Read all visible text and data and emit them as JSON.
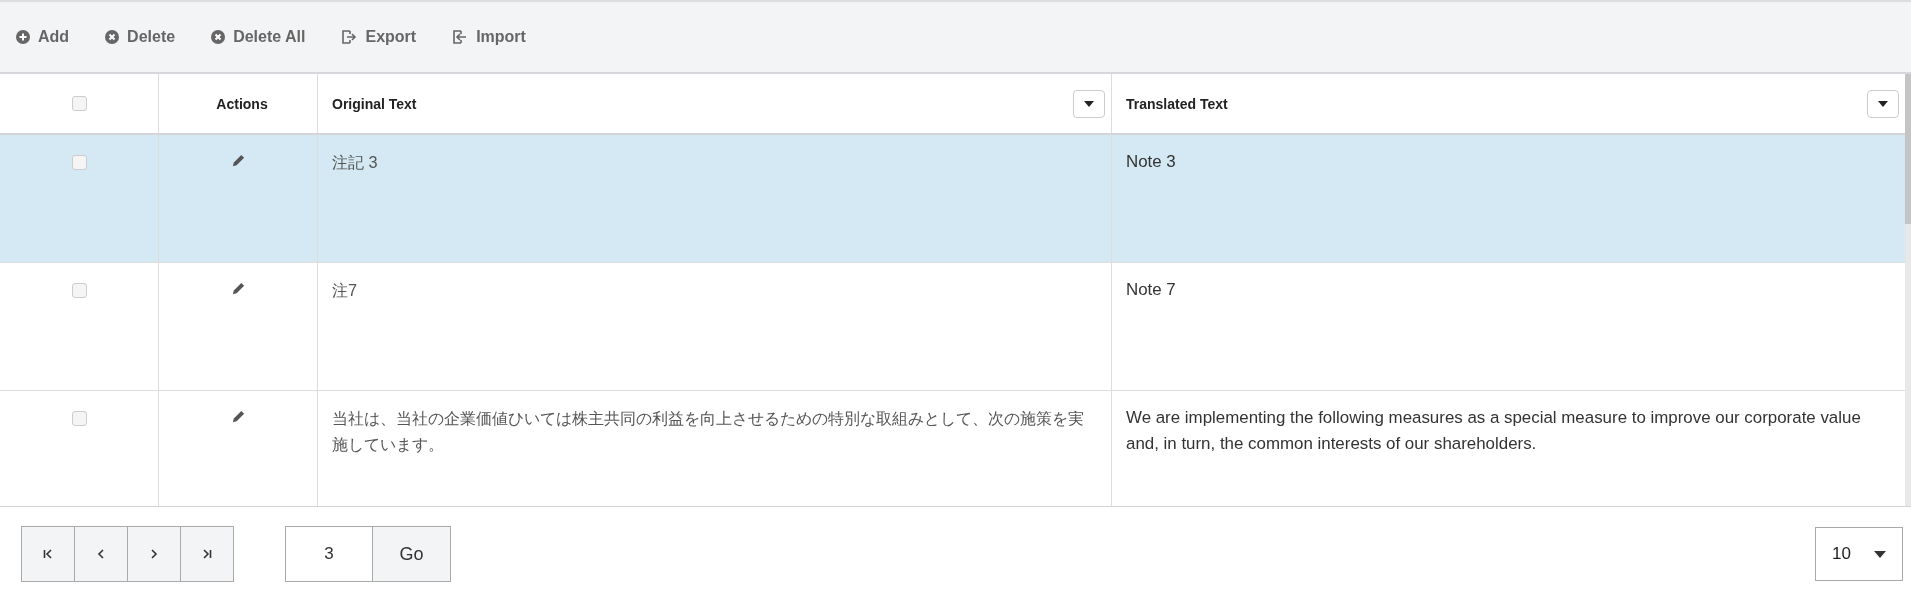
{
  "toolbar": [
    {
      "kind": "add",
      "label": "Add"
    },
    {
      "kind": "delete",
      "label": "Delete"
    },
    {
      "kind": "delete",
      "label": "Delete All"
    },
    {
      "kind": "export",
      "label": "Export"
    },
    {
      "kind": "import",
      "label": "Import"
    }
  ],
  "table": {
    "select_all_checked": false,
    "columns": [
      {
        "label": "Actions",
        "filter": false
      },
      {
        "label": "Original Text",
        "filter": true
      },
      {
        "label": "Translated Text",
        "filter": true
      }
    ],
    "rows": [
      {
        "selected": true,
        "checked": false,
        "original": "注記 3",
        "translated": "Note 3"
      },
      {
        "selected": false,
        "checked": false,
        "original": "注7",
        "translated": "Note 7"
      },
      {
        "selected": false,
        "checked": false,
        "original": "当社は、当社の企業価値ひいては株主共同の利益を向上させるための特別な取組みとして、次の施策を実施しています。",
        "translated": "We are implementing the following measures as a special measure to improve our corporate value and, in turn, the common interests of our shareholders."
      }
    ]
  },
  "pagination": {
    "page": "3",
    "go": "Go",
    "page_size": "10"
  }
}
